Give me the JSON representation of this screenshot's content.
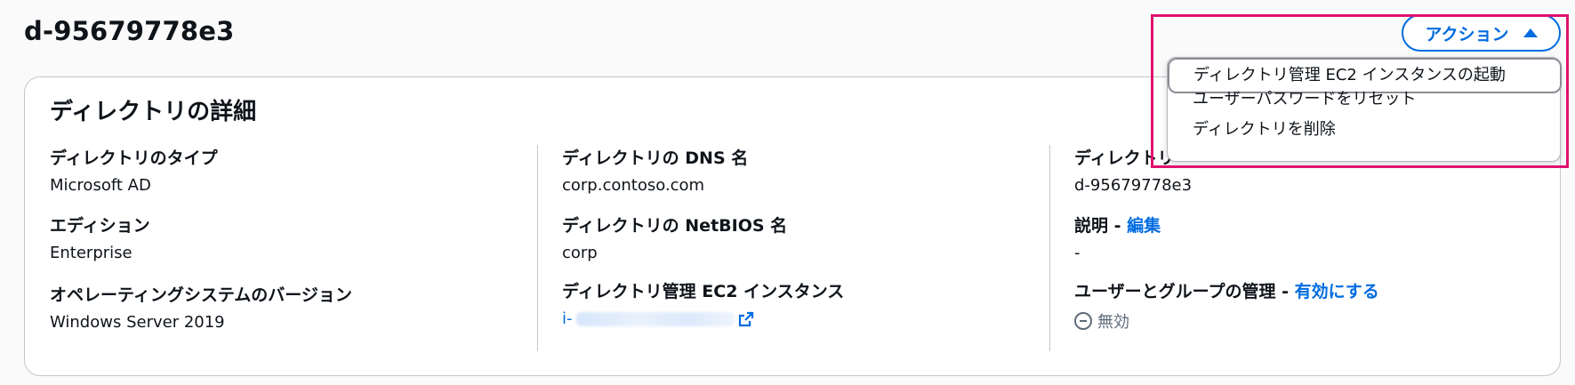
{
  "header": {
    "title": "d-95679778e3",
    "actions_label": "アクション"
  },
  "actions_menu": {
    "items": [
      {
        "label": "ディレクトリ管理 EC2 インスタンスの起動",
        "active": true
      },
      {
        "label": "ユーザーパスワードをリセット"
      },
      {
        "label": "ディレクトリを削除"
      }
    ]
  },
  "details": {
    "title": "ディレクトリの詳細",
    "directory_type": {
      "label": "ディレクトリのタイプ",
      "value": "Microsoft AD"
    },
    "edition": {
      "label": "エディション",
      "value": "Enterprise"
    },
    "os_version": {
      "label": "オペレーティングシステムのバージョン",
      "value": "Windows Server 2019"
    },
    "dns_name": {
      "label": "ディレクトリの DNS 名",
      "value": "corp.contoso.com"
    },
    "netbios_name": {
      "label": "ディレクトリの NetBIOS 名",
      "value": "corp"
    },
    "admin_instance": {
      "label": "ディレクトリ管理 EC2 インスタンス",
      "value_prefix": "i-"
    },
    "directory_id": {
      "label": "ディレクトリ",
      "value": "d-95679778e3"
    },
    "description": {
      "label": "説明 - ",
      "edit_link": "編集",
      "value": "-"
    },
    "user_group_mgmt": {
      "label": "ユーザーとグループの管理 - ",
      "enable_link": "有効にする",
      "status": "無効"
    }
  },
  "colors": {
    "link": "#006ce0",
    "highlight": "#e0116f",
    "text": "#0f141a",
    "muted": "#5f6b7a"
  }
}
